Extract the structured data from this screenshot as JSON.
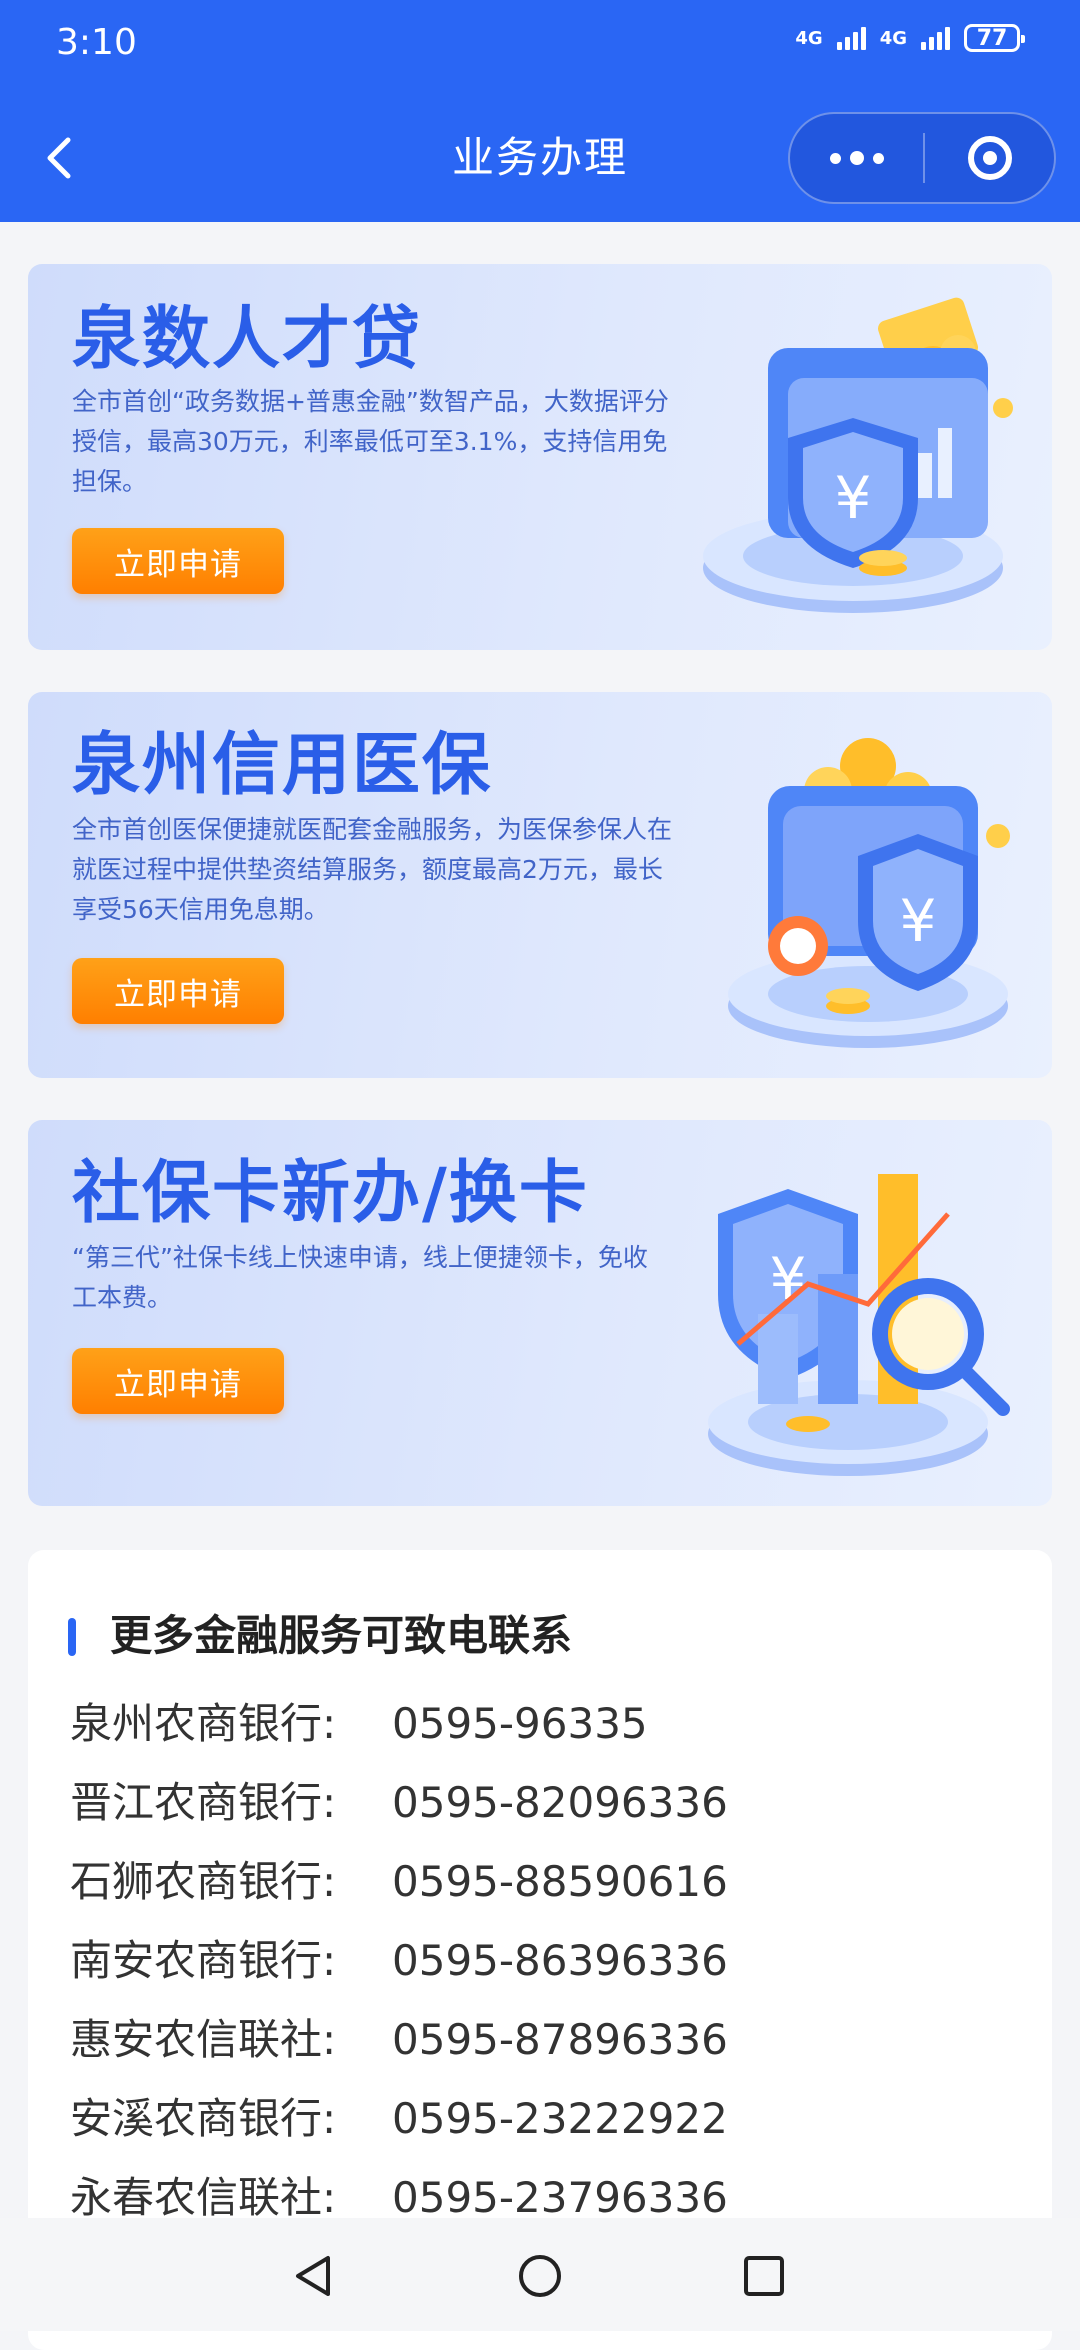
{
  "status": {
    "time": "3:10",
    "network1": "4G",
    "network2": "4G",
    "battery": "77"
  },
  "header": {
    "title": "业务办理"
  },
  "cards": [
    {
      "title": "泉数人才贷",
      "desc": "全市首创“政务数据+普惠金融”数智产品，大数据评分授信，最高30万元，利率最低可至3.1%，支持信用免担保。",
      "button": "立即申请",
      "illustration": "wallet-shield-icon"
    },
    {
      "title": "泉州信用医保",
      "desc": "全市首创医保便捷就医配套金融服务，为医保参保人在就医过程中提供垫资结算服务，额度最高2万元，最长享受56天信用免息期。",
      "button": "立即申请",
      "illustration": "shield-coins-icon"
    },
    {
      "title": "社保卡新办/换卡",
      "desc": "“第三代”社保卡线上快速申请，线上便捷领卡，免收工本费。",
      "button": "立即申请",
      "illustration": "shield-chart-magnifier-icon"
    }
  ],
  "contact": {
    "title": "更多金融服务可致电联系",
    "rows": [
      {
        "label": "泉州农商银行:",
        "phone": "0595-96335"
      },
      {
        "label": "晋江农商银行:",
        "phone": "0595-82096336"
      },
      {
        "label": "石狮农商银行:",
        "phone": "0595-88590616"
      },
      {
        "label": "南安农商银行:",
        "phone": "0595-86396336"
      },
      {
        "label": "惠安农信联社:",
        "phone": "0595-87896336"
      },
      {
        "label": "安溪农商银行:",
        "phone": "0595-23222922"
      },
      {
        "label": "永春农信联社:",
        "phone": "0595-23796336"
      }
    ]
  },
  "colors": {
    "primary": "#2a66f4",
    "accent": "#ff8c00",
    "card_title": "#2a5ee8"
  }
}
